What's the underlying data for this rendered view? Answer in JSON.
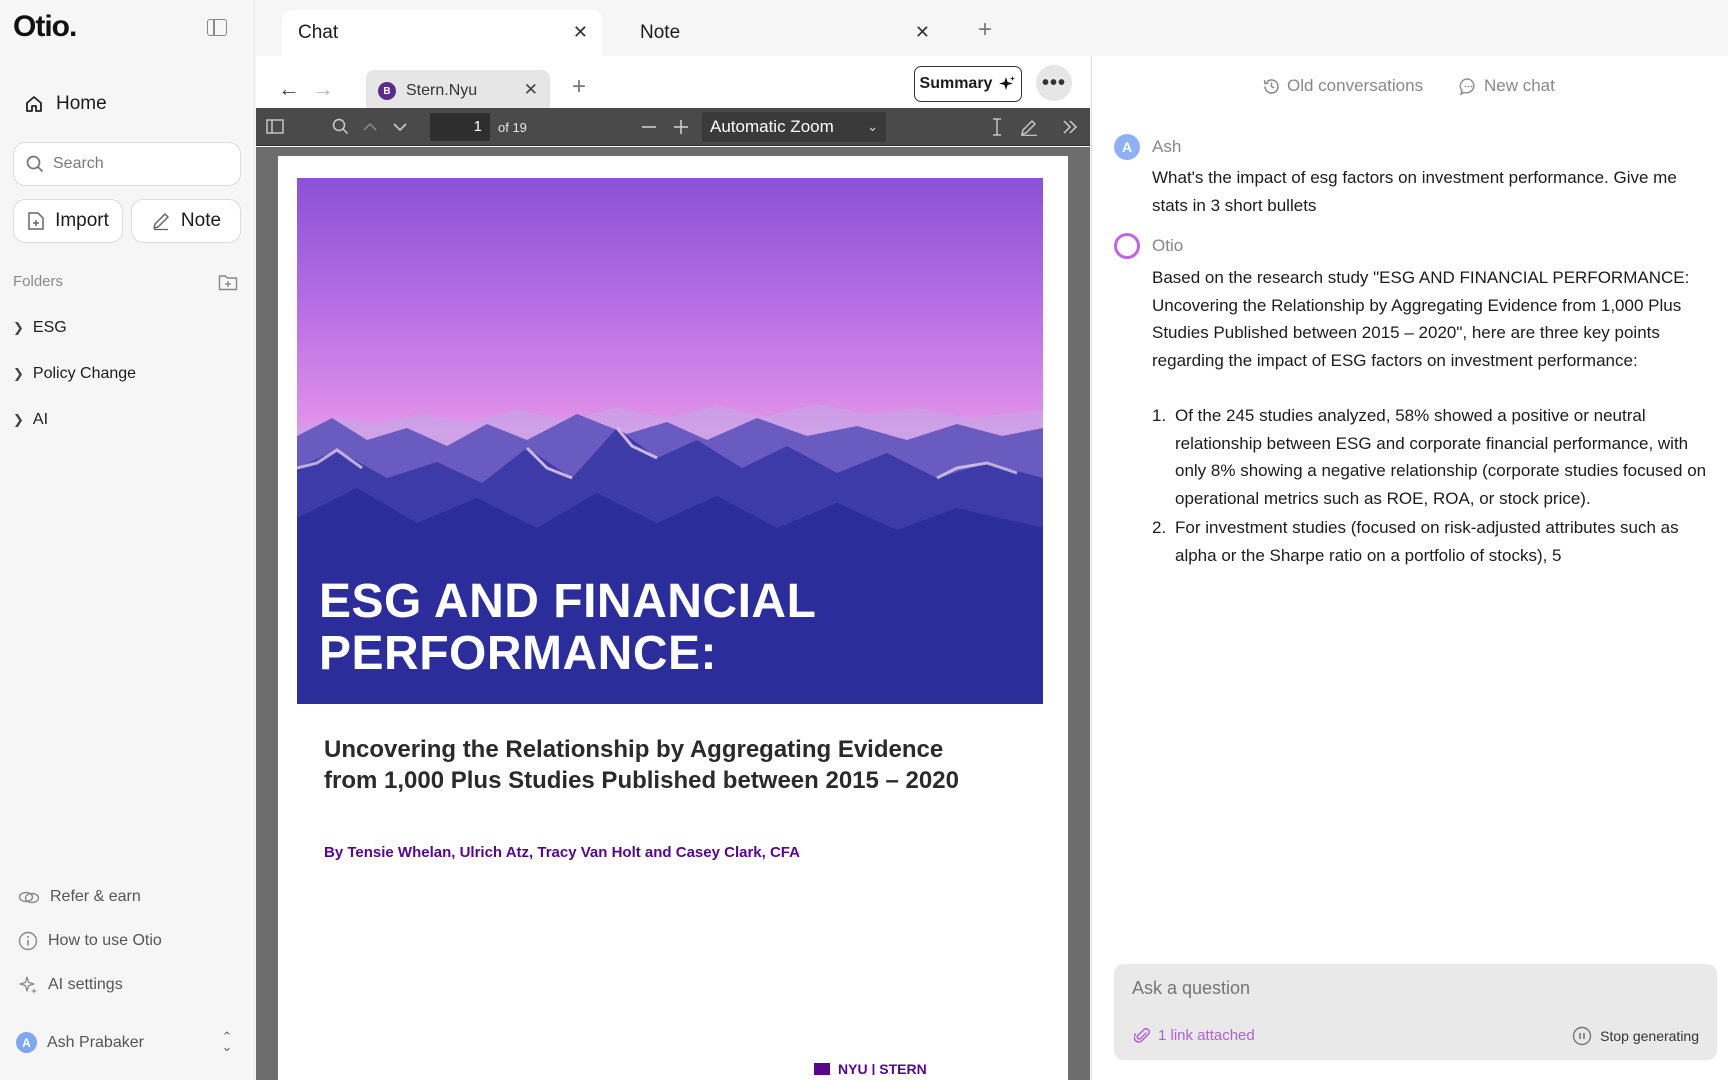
{
  "app": {
    "logo": "Otio."
  },
  "sidebar": {
    "home_label": "Home",
    "search_placeholder": "Search",
    "import_label": "Import",
    "note_label": "Note",
    "folders_label": "Folders",
    "folders": [
      {
        "label": "ESG"
      },
      {
        "label": "Policy Change"
      },
      {
        "label": "AI"
      }
    ],
    "bottom_items": [
      {
        "label": "Refer & earn",
        "icon": "coins-icon"
      },
      {
        "label": "How to use Otio",
        "icon": "info-icon"
      },
      {
        "label": "AI settings",
        "icon": "sparkle-icon"
      }
    ],
    "user": {
      "initial": "A",
      "name": "Ash Prabaker"
    }
  },
  "top_tabs": [
    {
      "label": "Chat",
      "active": true
    },
    {
      "label": "Note",
      "active": false
    }
  ],
  "viewer": {
    "doc_tab": {
      "favicon_letter": "B",
      "label": "Stern.Nyu"
    },
    "summary_label": "Summary",
    "more_label": "•••",
    "toolbar": {
      "page_current": "1",
      "page_total_label": "of 19",
      "zoom_label": "Automatic Zoom"
    },
    "document": {
      "cover_title_line1": "ESG AND FINANCIAL",
      "cover_title_line2": "PERFORMANCE:",
      "subtitle": "Uncovering the Relationship by Aggregating Evidence from 1,000 Plus Studies Published between 2015 – 2020",
      "byline": "By Tensie Whelan, Ulrich Atz, Tracy Van Holt and Casey Clark, CFA",
      "footer_logo": "NYU | STERN"
    }
  },
  "chat": {
    "old_conversations_label": "Old conversations",
    "new_chat_label": "New chat",
    "user_message": {
      "initial": "A",
      "author": "Ash",
      "text": "What's the impact of esg factors on investment performance. Give me stats in 3 short bullets"
    },
    "ai_message": {
      "author": "Otio",
      "intro": "Based on the research study \"ESG AND FINANCIAL PERFORMANCE: Uncovering the Relationship by Aggregating Evidence from 1,000 Plus Studies Published between 2015 – 2020\", here are three key points regarding the impact of ESG factors on investment performance:",
      "items": [
        {
          "num": "1.",
          "text": "Of the 245 studies analyzed, 58% showed a positive or neutral relationship between ESG and corporate financial performance, with only 8% showing a negative relationship (corporate studies focused on operational metrics such as ROE, ROA, or stock price)."
        },
        {
          "num": "2.",
          "text": "For investment studies (focused on risk-adjusted attributes such as alpha or the Sharpe ratio on a portfolio of stocks), 5"
        }
      ]
    },
    "ask_placeholder": "Ask a question",
    "link_attached_label": "1 link attached",
    "stop_generating_label": "Stop generating"
  },
  "colors": {
    "accent_purple": "#c262e6",
    "byline_purple": "#57068c",
    "pdf_toolbar": "#4a4a4a",
    "avatar_blue": "#7fa6f0"
  }
}
